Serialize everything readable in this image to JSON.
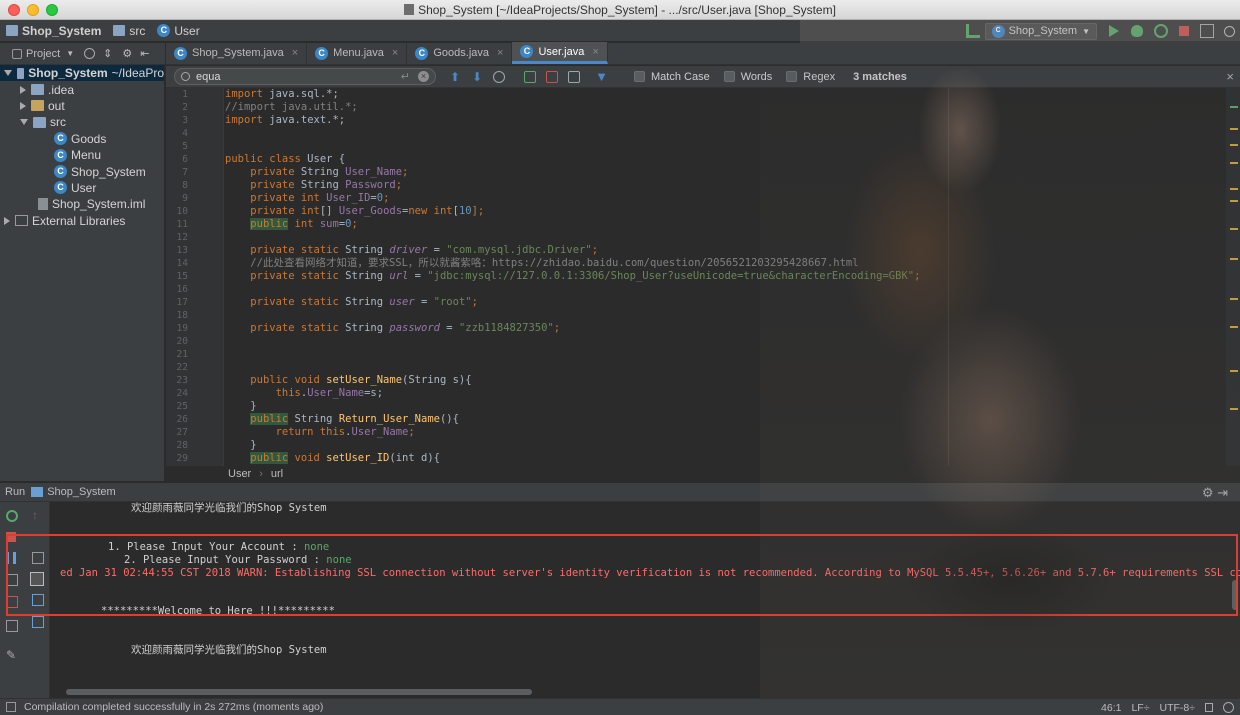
{
  "window": {
    "title": "Shop_System [~/IdeaProjects/Shop_System] - .../src/User.java [Shop_System]"
  },
  "navbar": {
    "project": "Shop_System",
    "folder": "src",
    "file": "User",
    "run_config": "Shop_System"
  },
  "project_panel": {
    "header": "Project",
    "tree": [
      {
        "label": "Shop_System",
        "suffix": "~/IdeaPro",
        "type": "folder"
      },
      {
        "label": ".idea",
        "type": "folder"
      },
      {
        "label": "out",
        "type": "folder"
      },
      {
        "label": "src",
        "type": "folder"
      },
      {
        "label": "Goods",
        "type": "class"
      },
      {
        "label": "Menu",
        "type": "class"
      },
      {
        "label": "Shop_System",
        "type": "class"
      },
      {
        "label": "User",
        "type": "class"
      },
      {
        "label": "Shop_System.iml",
        "type": "file"
      },
      {
        "label": "External Libraries",
        "type": "lib"
      }
    ]
  },
  "tabs": [
    {
      "label": "Shop_System.java"
    },
    {
      "label": "Menu.java"
    },
    {
      "label": "Goods.java"
    },
    {
      "label": "User.java"
    }
  ],
  "search": {
    "query": "equa",
    "match_case": "Match Case",
    "words": "Words",
    "regex": "Regex",
    "matches": "3 matches"
  },
  "code": {
    "line_numbers": [
      "1",
      "2",
      "3",
      "4",
      "5",
      "6",
      "7",
      "8",
      "9",
      "10",
      "11",
      "12",
      "13",
      "14",
      "15",
      "16",
      "17",
      "18",
      "19",
      "20",
      "21",
      "22",
      "23",
      "24",
      "25",
      "26",
      "27",
      "28",
      "29"
    ],
    "l1_kw": "import",
    "l1_rest": " java.sql.*;",
    "l2": "//import java.util.*;",
    "l3_kw": "import",
    "l3_rest": " java.text.*;",
    "l6_kw": "public class",
    "l6_rest": " User {",
    "l7_kw": "private",
    "l7_type": " String ",
    "l7_fld": "User_Name",
    "l7_end": ";",
    "l8_kw": "private",
    "l8_type": " String ",
    "l8_fld": "Password",
    "l8_end": ";",
    "l9_kw": "private int",
    "l9_fld": " User_ID",
    "l9_eq": "=",
    "l9_num": "0",
    "l9_end": ";",
    "l10_kw": "private int",
    "l10_mid": "[] ",
    "l10_fld": "User_Goods",
    "l10_eq": "=",
    "l10_new": "new int",
    "l10_br": "[",
    "l10_num": "10",
    "l10_end": "];",
    "l11_hl": "public",
    "l11_kw": " int",
    "l11_fld": " sum",
    "l11_eq": "=",
    "l11_num": "0",
    "l11_end": ";",
    "l13_kw": "private static",
    "l13_type": " String ",
    "l13_fld": "driver",
    "l13_eq": " = ",
    "l13_str": "\"com.mysql.jdbc.Driver\"",
    "l13_end": ";",
    "l14": "//此处查看网络才知道，要求SSL，所以就酱紫咯：https://zhidao.baidu.com/question/2056521203295428667.html",
    "l15_kw": "private static",
    "l15_type": " String ",
    "l15_fld": "url",
    "l15_eq": " = ",
    "l15_str": "\"jdbc:mysql://127.0.0.1:3306/Shop_User?useUnicode=true&characterEncoding=GBK\"",
    "l15_end": ";",
    "l17_kw": "private static",
    "l17_type": " String ",
    "l17_fld": "user",
    "l17_eq": " = ",
    "l17_str": "\"root\"",
    "l17_end": ";",
    "l19_kw": "private static",
    "l19_type": " String ",
    "l19_fld": "password",
    "l19_eq": " = ",
    "l19_str": "\"zzb1184827350\"",
    "l19_end": ";",
    "l23_kw": "public void",
    "l23_fn": " setUser_Name",
    "l23_rest": "(String s){",
    "l24_kw": "this",
    "l24_dot": ".",
    "l24_fld": "User_Name",
    "l24_rest": "=s;",
    "l25": "}",
    "l26_hl": "public",
    "l26_type": " String ",
    "l26_fn": "Return_User_Name",
    "l26_rest": "(){",
    "l27_kw": "return this",
    "l27_dot": ".",
    "l27_fld": "User_Name",
    "l27_end": ";",
    "l28": "}",
    "l29_hl": "public",
    "l29_kw": " void",
    "l29_fn": " setUser_ID",
    "l29_rest": "(int d){"
  },
  "editor_breadcrumb": {
    "class": "User",
    "member": "url"
  },
  "run_panel": {
    "label": "Run",
    "config": "Shop_System"
  },
  "console": {
    "welcome1": "欢迎颜雨薇同学光临我们的Shop System",
    "prompt_account": "1. Please Input Your Account : ",
    "account_value": "none",
    "prompt_password": "2. Please Input Your Password : ",
    "password_value": "none",
    "warning": "ed Jan 31 02:44:55 CST 2018 WARN: Establishing SSL connection without server's identity verification is not recommended. According to MySQL 5.5.45+, 5.6.26+ and 5.7.6+ requirements SSL connection",
    "welcome_here": "*********Welcome to Here !!!*********",
    "welcome2": "欢迎颜雨薇同学光临我们的Shop System"
  },
  "statusbar": {
    "message": "Compilation completed successfully in 2s 272ms (moments ago)",
    "position": "46:1",
    "line_sep": "LF÷",
    "encoding": "UTF-8÷"
  }
}
